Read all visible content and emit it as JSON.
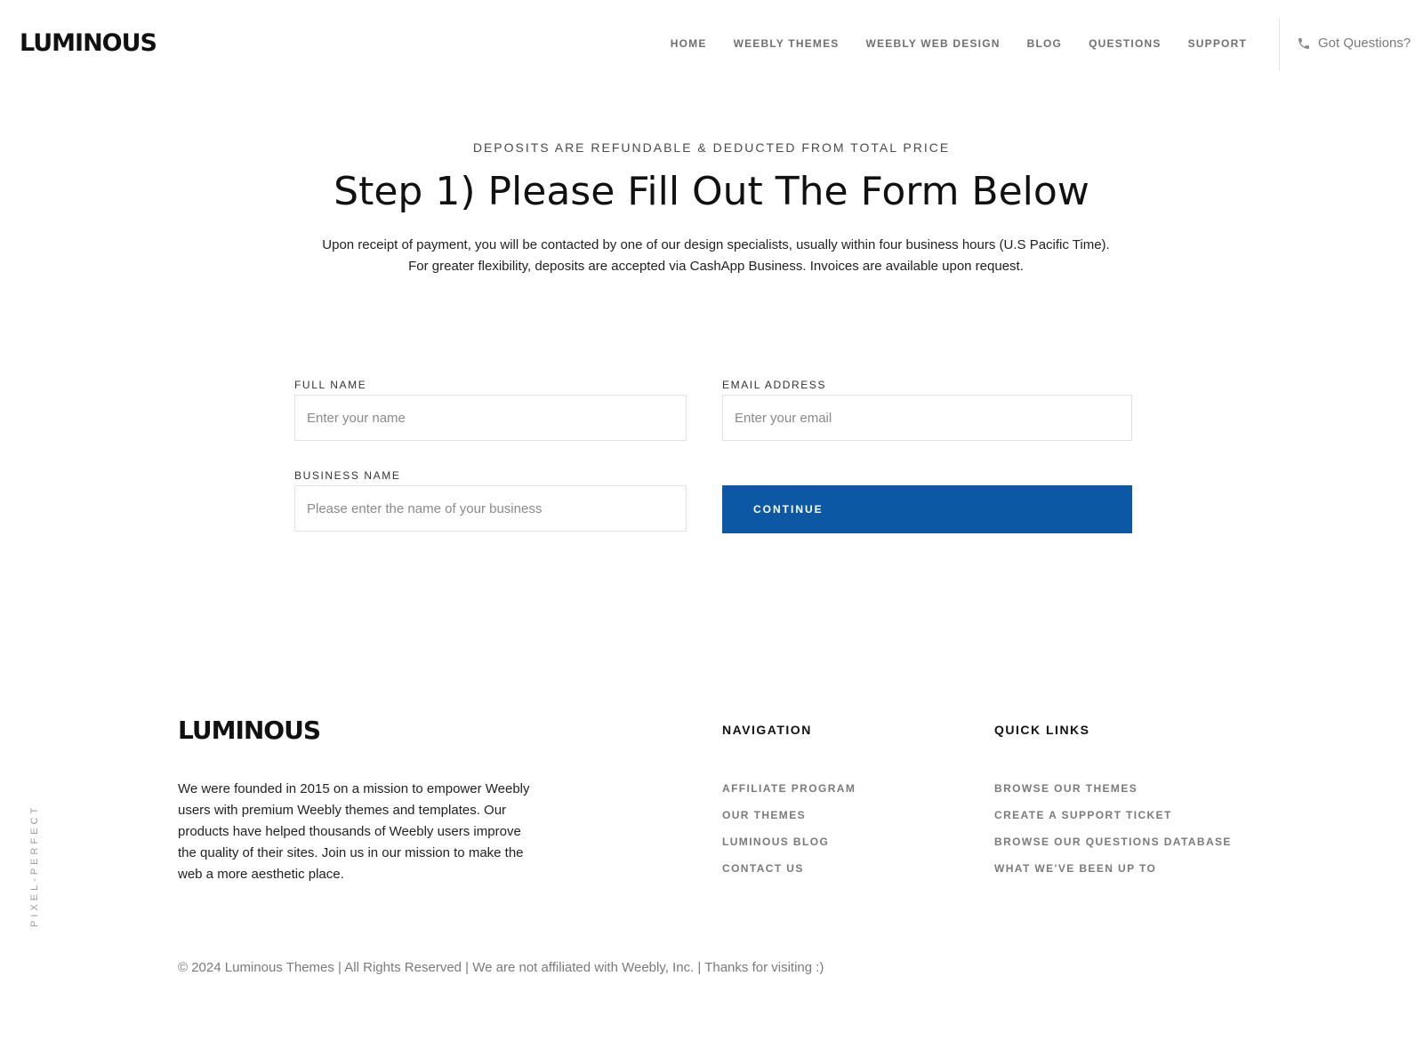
{
  "header": {
    "logo": "LUMINOUS",
    "nav": [
      "HOME",
      "WEEBLY THEMES",
      "WEEBLY WEB DESIGN",
      "BLOG",
      "QUESTIONS",
      "SUPPORT"
    ],
    "contact_label": "Got Questions?",
    "contact_icon": "phone-icon"
  },
  "hero": {
    "eyebrow": "DEPOSITS ARE REFUNDABLE & DEDUCTED FROM TOTAL PRICE",
    "title": "Step 1) Please Fill Out The Form Below",
    "intro": "Upon receipt of payment, you will be contacted by one of our design specialists, usually within four business hours (U.S Pacific Time). For greater flexibility, deposits are accepted via CashApp Business. Invoices are available upon request."
  },
  "form": {
    "full_name": {
      "label": "FULL NAME",
      "placeholder": "Enter your name",
      "value": ""
    },
    "email": {
      "label": "EMAIL ADDRESS",
      "placeholder": "Enter your email",
      "value": ""
    },
    "business": {
      "label": "BUSINESS NAME",
      "placeholder": "Please enter the name of your business",
      "value": ""
    },
    "submit_label": "CONTINUE",
    "accent_color": "#0c58a5"
  },
  "footer": {
    "logo": "LUMINOUS",
    "about": "We were founded in 2015 on a mission to empower Weebly users with premium Weebly themes and templates. Our products have helped thousands of Weebly users improve the quality of their sites. Join us in our mission to make the web a more aesthetic place.",
    "navigation_heading": "NAVIGATION",
    "navigation_links": [
      "AFFILIATE PROGRAM",
      "OUR THEMES",
      "LUMINOUS BLOG",
      "CONTACT US"
    ],
    "quick_links_heading": "QUICK LINKS",
    "quick_links": [
      "BROWSE OUR THEMES",
      "CREATE A SUPPORT TICKET",
      "BROWSE OUR QUESTIONS DATABASE",
      "WHAT WE'VE BEEN UP TO"
    ],
    "copyright": "© 2024 Luminous Themes | All Rights Reserved | We are not affiliated with Weebly, Inc. | Thanks for visiting :)",
    "vertical_tag": "PIXEL-PERFECT"
  }
}
